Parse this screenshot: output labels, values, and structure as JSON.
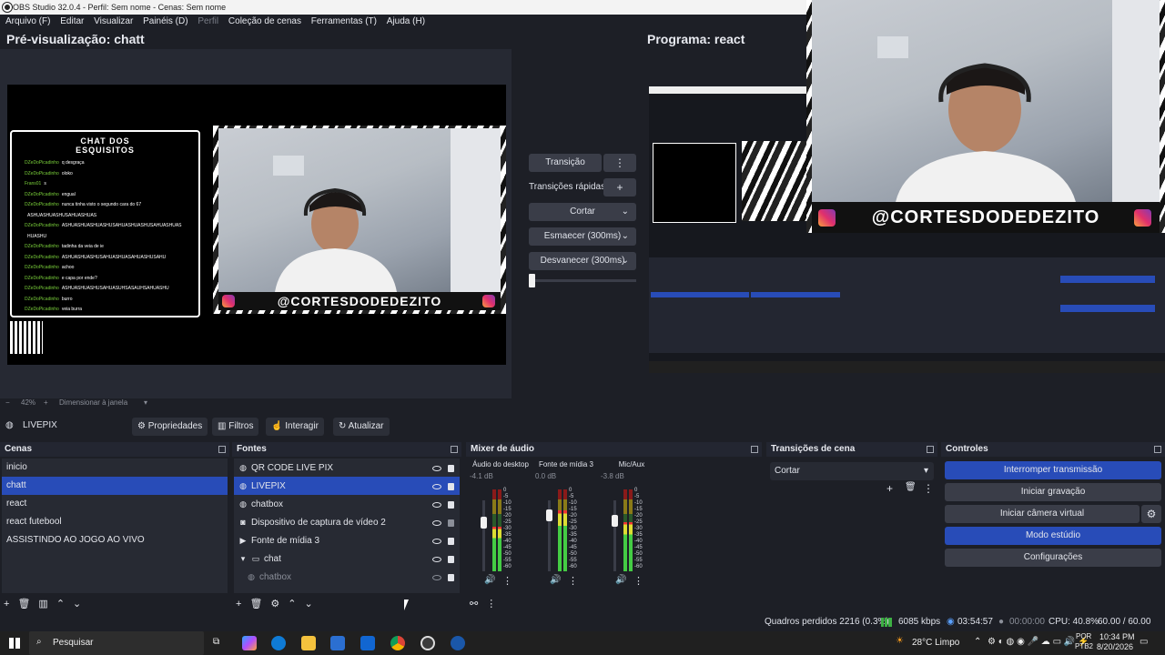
{
  "window": {
    "title": "OBS Studio 32.0.4 - Perfil: Sem nome - Cenas: Sem nome"
  },
  "menu": [
    "Arquivo (F)",
    "Editar",
    "Visualizar",
    "Painéis (D)",
    "Perfil",
    "Coleção de cenas",
    "Ferramentas (T)",
    "Ajuda (H)"
  ],
  "preview": {
    "title": "Pré-visualização: chatt",
    "zoom": "42%",
    "zoom_mode": "Dimensionar à janela",
    "chat_title_line1": "CHAT DOS",
    "chat_title_line2": "ESQUISITOS",
    "chat_lines": [
      {
        "user": "DZeDoPicadinho",
        "msg": "q desgraça"
      },
      {
        "user": "DZeDoPicadinho",
        "msg": "oloko"
      },
      {
        "user": "Frans01",
        "msg": "s"
      },
      {
        "user": "DZeDoPicadinho",
        "msg": "engual"
      },
      {
        "user": "DZeDoPicadinho",
        "msg": "nunca tinha visto o segundo cara do 67"
      },
      {
        "user": "",
        "msg": "ASHUASHUASHUSAHUASHUAS"
      },
      {
        "user": "DZeDoPicadinho",
        "msg": "ASHUASHUASHUASHUSAHUASHUASHUSAHUASHUAS"
      },
      {
        "user": "",
        "msg": "HUASHU"
      },
      {
        "user": "DZeDoPicadinho",
        "msg": "tadinha da veia de ie"
      },
      {
        "user": "DZeDoPicadinho",
        "msg": "ASHUASHUASHUSAHUASHUASAHUASHUSAHU"
      },
      {
        "user": "DZeDoPicadinho",
        "msg": "achoo"
      },
      {
        "user": "DZeDoPicadinho",
        "msg": "e capa por ende?"
      },
      {
        "user": "DZeDoPicadinho",
        "msg": "ASHUASHUASHUSAHUASUHSASAUHSAHUASHU"
      },
      {
        "user": "DZeDoPicadinho",
        "msg": "burro"
      },
      {
        "user": "DZeDoPicadinho",
        "msg": "veia burra"
      }
    ],
    "banner": "@CORTESDODEDEZITO"
  },
  "program": {
    "title": "Programa: react",
    "banner": "@CORTESDODEDEZITO"
  },
  "transitions_panel": {
    "transition_label": "Transição",
    "quick_label": "Transições rápidas",
    "items": [
      "Cortar",
      "Esmaecer (300ms)",
      "Desvanecer (300ms)"
    ]
  },
  "source_toolbar": {
    "source_name": "LIVEPIX",
    "buttons": [
      "Propriedades",
      "Filtros",
      "Interagir",
      "Atualizar"
    ]
  },
  "scenes": {
    "title": "Cenas",
    "items": [
      "inicio",
      "chatt",
      "react",
      "react futebool",
      "ASSISTINDO AO JOGO AO VIVO"
    ],
    "selected": "chatt"
  },
  "sources": {
    "title": "Fontes",
    "items": [
      {
        "name": "QR CODE LIVE PIX",
        "icon": "globe-icon"
      },
      {
        "name": "LIVEPIX",
        "icon": "globe-icon"
      },
      {
        "name": "chatbox",
        "icon": "globe-icon"
      },
      {
        "name": "Dispositivo de captura de vídeo 2",
        "icon": "camera-icon"
      },
      {
        "name": "Fonte de mídia 3",
        "icon": "play-icon"
      },
      {
        "name": "chat",
        "icon": "folder-icon"
      },
      {
        "name": "chatbox",
        "icon": "globe-icon"
      }
    ]
  },
  "mixer": {
    "title": "Mixer de áudio",
    "channels": [
      {
        "name": "Áudio do desktop",
        "db": "-4.1 dB",
        "level": 0.55
      },
      {
        "name": "Fonte de mídia 3",
        "db": "0.0 dB",
        "level": 0.75
      },
      {
        "name": "Mic/Aux",
        "db": "-3.8 dB",
        "level": 0.6
      }
    ],
    "scale": [
      "0",
      "-5",
      "-10",
      "-15",
      "-20",
      "-25",
      "-30",
      "-35",
      "-40",
      "-45",
      "-50",
      "-55",
      "-60"
    ]
  },
  "scene_transitions": {
    "title": "Transições de cena",
    "selected": "Cortar"
  },
  "controls": {
    "title": "Controles",
    "buttons": [
      "Interromper transmissão",
      "Iniciar gravação",
      "Iniciar câmera virtual",
      "Modo estúdio",
      "Configurações"
    ]
  },
  "status": {
    "dropped": "Quadros perdidos 2216 (0.3%)",
    "bitrate": "6085 kbps",
    "stream_time": "03:54:57",
    "rec_time": "00:00:00",
    "cpu": "CPU: 40.8%",
    "fps": "60.00 / 60.00 FPS"
  },
  "taskbar": {
    "search": "Pesquisar",
    "weather": "28°C  Limpo",
    "lang1": "POR",
    "lang2": "PTB2",
    "time": "10:34 PM",
    "date": "8/20/2026"
  },
  "colors": {
    "selected": "#284cb8",
    "panel": "#272a33",
    "bg": "#1d1f26"
  }
}
